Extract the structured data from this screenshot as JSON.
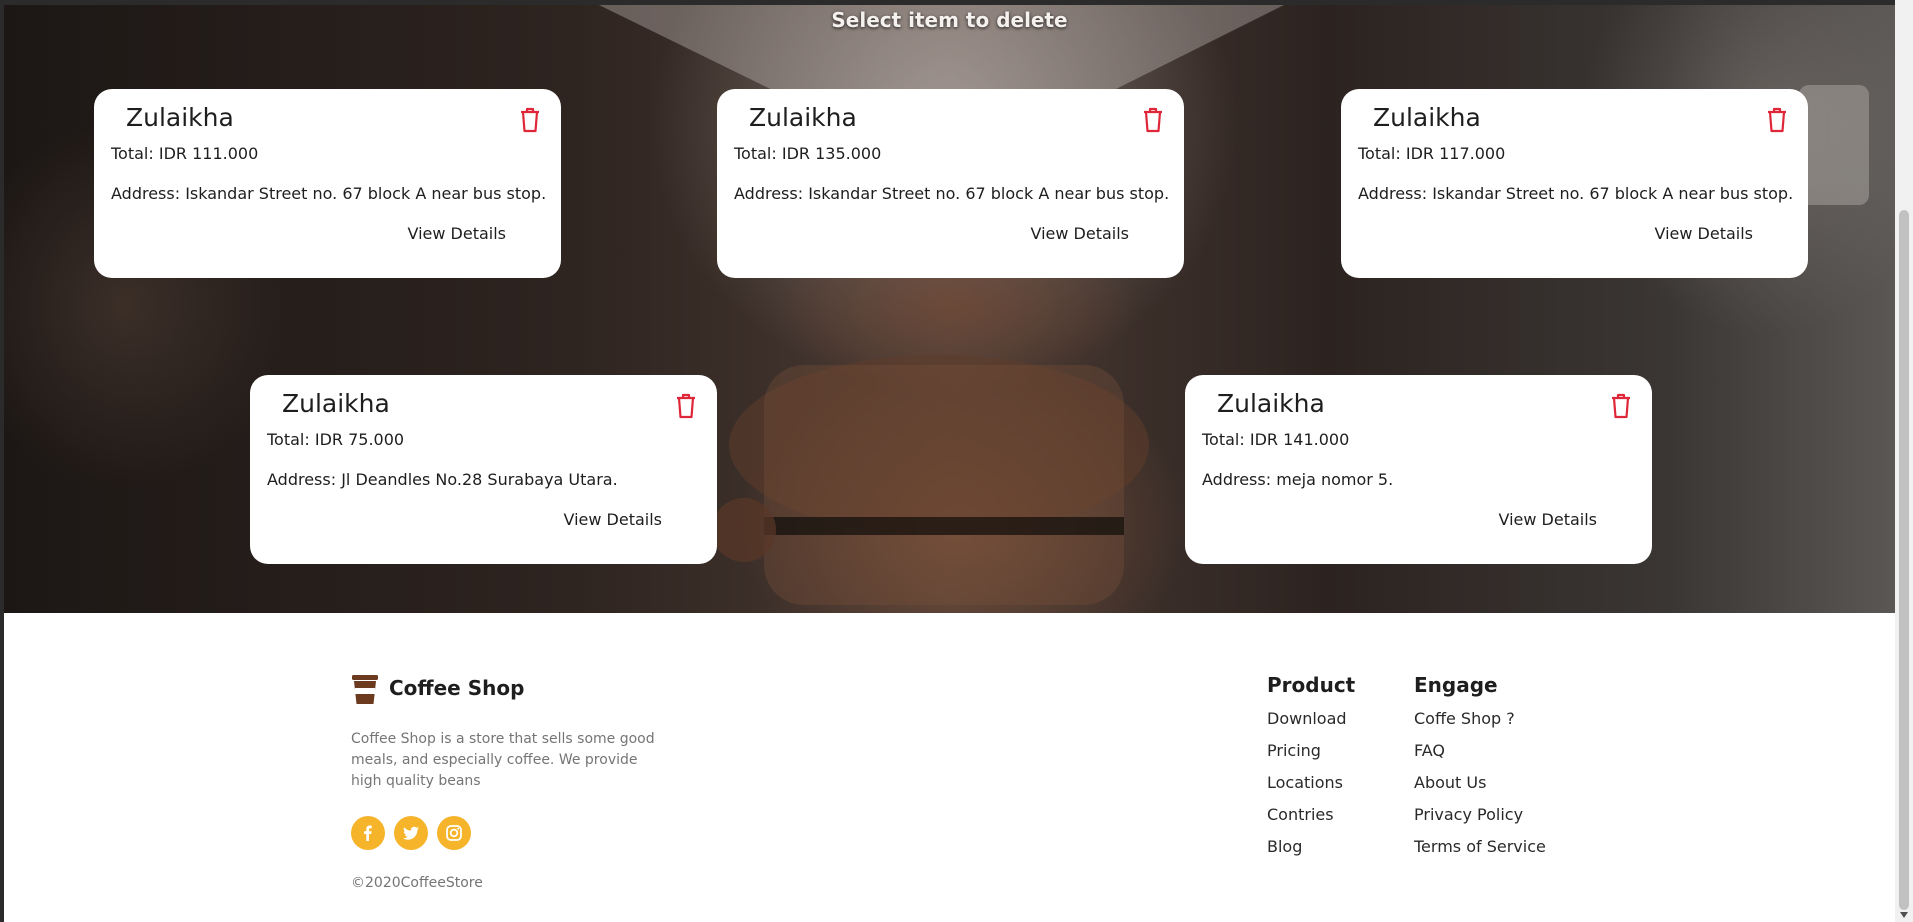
{
  "hero": {
    "title": "Select item to delete"
  },
  "orders": [
    {
      "name": "Zulaikha",
      "total": "Total: IDR 111.000",
      "address": "Address: Iskandar Street no. 67 block A near bus stop.",
      "details": "View Details"
    },
    {
      "name": "Zulaikha",
      "total": "Total: IDR 135.000",
      "address": "Address: Iskandar Street no. 67 block A near bus stop.",
      "details": "View Details"
    },
    {
      "name": "Zulaikha",
      "total": "Total: IDR 117.000",
      "address": "Address: Iskandar Street no. 67 block A near bus stop.",
      "details": "View Details"
    },
    {
      "name": "Zulaikha",
      "total": "Total: IDR 75.000",
      "address": "Address: Jl Deandles No.28 Surabaya Utara.",
      "details": "View Details"
    },
    {
      "name": "Zulaikha",
      "total": "Total: IDR 141.000",
      "address": "Address: meja nomor 5.",
      "details": "View Details"
    }
  ],
  "colors": {
    "trash": "#e0273a",
    "social": "#f5b42a",
    "brand_icon": "#6b3a1f"
  },
  "footer": {
    "brand": "Coffee Shop",
    "description": "Coffee Shop is a store that sells some good meals, and especially coffee. We provide high quality beans",
    "social": [
      "facebook-icon",
      "twitter-icon",
      "instagram-icon"
    ],
    "copyright": "©2020CoffeeStore",
    "product": {
      "title": "Product",
      "links": [
        "Download",
        "Pricing",
        "Locations",
        "Contries",
        "Blog"
      ]
    },
    "engage": {
      "title": "Engage",
      "links": [
        "Coffe Shop ?",
        "FAQ",
        "About Us",
        "Privacy Policy",
        "Terms of Service"
      ]
    }
  }
}
